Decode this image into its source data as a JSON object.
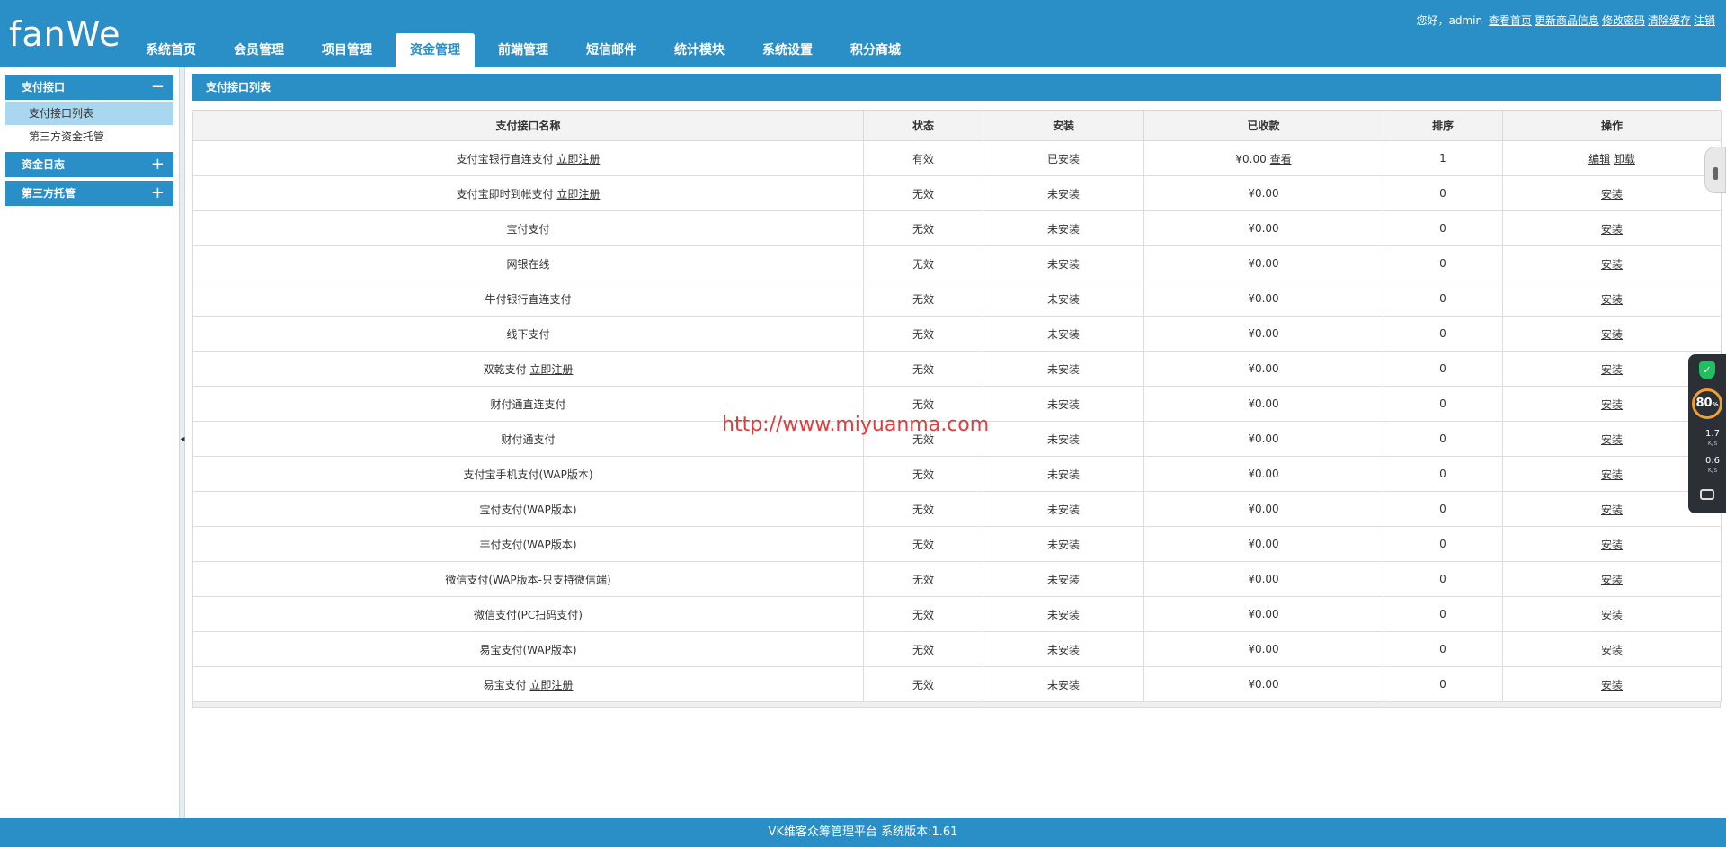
{
  "header": {
    "logo_text": "fanWe",
    "nav": [
      {
        "label": "系统首页",
        "active": false
      },
      {
        "label": "会员管理",
        "active": false
      },
      {
        "label": "项目管理",
        "active": false
      },
      {
        "label": "资金管理",
        "active": true
      },
      {
        "label": "前端管理",
        "active": false
      },
      {
        "label": "短信邮件",
        "active": false
      },
      {
        "label": "统计模块",
        "active": false
      },
      {
        "label": "系统设置",
        "active": false
      },
      {
        "label": "积分商城",
        "active": false
      }
    ],
    "greeting": "您好，admin",
    "links": [
      "查看首页",
      "更新商品信息",
      "修改密码",
      "清除缓存",
      "注销"
    ]
  },
  "sidebar": {
    "groups": [
      {
        "title": "支付接口",
        "toggle": "−",
        "items": [
          {
            "label": "支付接口列表",
            "active": true
          },
          {
            "label": "第三方资金托管",
            "active": false
          }
        ]
      },
      {
        "title": "资金日志",
        "toggle": "+",
        "items": []
      },
      {
        "title": "第三方托管",
        "toggle": "+",
        "items": []
      }
    ],
    "collapse_arrow": "◂"
  },
  "main": {
    "title": "支付接口列表",
    "columns": [
      "支付接口名称",
      "状态",
      "安装",
      "已收款",
      "排序",
      "操作"
    ],
    "rows": [
      {
        "name": "支付宝银行直连支付",
        "register": "立即注册",
        "status": "有效",
        "install": "已安装",
        "received": "¥0.00",
        "view": "查看",
        "sort": "1",
        "actions": [
          "编辑",
          "卸载"
        ]
      },
      {
        "name": "支付宝即时到帐支付",
        "register": "立即注册",
        "status": "无效",
        "install": "未安装",
        "received": "¥0.00",
        "view": "",
        "sort": "0",
        "actions": [
          "安装"
        ]
      },
      {
        "name": "宝付支付",
        "register": "",
        "status": "无效",
        "install": "未安装",
        "received": "¥0.00",
        "view": "",
        "sort": "0",
        "actions": [
          "安装"
        ]
      },
      {
        "name": "网银在线",
        "register": "",
        "status": "无效",
        "install": "未安装",
        "received": "¥0.00",
        "view": "",
        "sort": "0",
        "actions": [
          "安装"
        ]
      },
      {
        "name": "牛付银行直连支付",
        "register": "",
        "status": "无效",
        "install": "未安装",
        "received": "¥0.00",
        "view": "",
        "sort": "0",
        "actions": [
          "安装"
        ]
      },
      {
        "name": "线下支付",
        "register": "",
        "status": "无效",
        "install": "未安装",
        "received": "¥0.00",
        "view": "",
        "sort": "0",
        "actions": [
          "安装"
        ]
      },
      {
        "name": "双乾支付",
        "register": "立即注册",
        "status": "无效",
        "install": "未安装",
        "received": "¥0.00",
        "view": "",
        "sort": "0",
        "actions": [
          "安装"
        ]
      },
      {
        "name": "财付通直连支付",
        "register": "",
        "status": "无效",
        "install": "未安装",
        "received": "¥0.00",
        "view": "",
        "sort": "0",
        "actions": [
          "安装"
        ]
      },
      {
        "name": "财付通支付",
        "register": "",
        "status": "无效",
        "install": "未安装",
        "received": "¥0.00",
        "view": "",
        "sort": "0",
        "actions": [
          "安装"
        ]
      },
      {
        "name": "支付宝手机支付(WAP版本)",
        "register": "",
        "status": "无效",
        "install": "未安装",
        "received": "¥0.00",
        "view": "",
        "sort": "0",
        "actions": [
          "安装"
        ]
      },
      {
        "name": "宝付支付(WAP版本)",
        "register": "",
        "status": "无效",
        "install": "未安装",
        "received": "¥0.00",
        "view": "",
        "sort": "0",
        "actions": [
          "安装"
        ]
      },
      {
        "name": "丰付支付(WAP版本)",
        "register": "",
        "status": "无效",
        "install": "未安装",
        "received": "¥0.00",
        "view": "",
        "sort": "0",
        "actions": [
          "安装"
        ]
      },
      {
        "name": "微信支付(WAP版本-只支持微信端)",
        "register": "",
        "status": "无效",
        "install": "未安装",
        "received": "¥0.00",
        "view": "",
        "sort": "0",
        "actions": [
          "安装"
        ]
      },
      {
        "name": "微信支付(PC扫码支付)",
        "register": "",
        "status": "无效",
        "install": "未安装",
        "received": "¥0.00",
        "view": "",
        "sort": "0",
        "actions": [
          "安装"
        ]
      },
      {
        "name": "易宝支付(WAP版本)",
        "register": "",
        "status": "无效",
        "install": "未安装",
        "received": "¥0.00",
        "view": "",
        "sort": "0",
        "actions": [
          "安装"
        ]
      },
      {
        "name": "易宝支付",
        "register": "立即注册",
        "status": "无效",
        "install": "未安装",
        "received": "¥0.00",
        "view": "",
        "sort": "0",
        "actions": [
          "安装"
        ]
      }
    ]
  },
  "watermark": "http://www.miyuanma.com",
  "footer": {
    "text": "VK维客众筹管理平台 系统版本:1.61"
  },
  "widget": {
    "shield_glyph": "✓",
    "percent": "80",
    "percent_unit": "%",
    "up_speed": "1.7",
    "down_speed": "0.6",
    "speed_unit": "K/s"
  },
  "colors": {
    "primary": "#2a8fc7",
    "sidebar_active": "#a9d7ef",
    "watermark": "#e23b3b"
  }
}
